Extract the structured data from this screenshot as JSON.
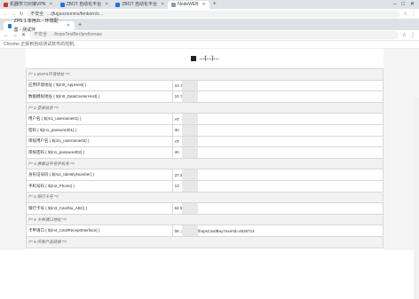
{
  "outer_tabs": [
    {
      "label": "机器学习对接VPN",
      "color": "#d93025",
      "active": false
    },
    {
      "label": "ZBOT 自动化平台",
      "color": "#1a73e8",
      "active": false
    },
    {
      "label": "ZBOT 自动化平台",
      "color": "#1a73e8",
      "active": false
    },
    {
      "label": "NodeWEB",
      "color": "#999999",
      "active": true
    }
  ],
  "outer_toolbar": {
    "security": "不安全",
    "url": "…/jfuguozsonms/fenborn/s…"
  },
  "inner_tab": {
    "label": "ZPS 1.本用JL - 环境配置 - 测试环"
  },
  "inner_toolbar": {
    "security": "不安全",
    "url": "…/bopsTestBer/prefixeraw"
  },
  "notice": "Chrome 正受到自动测试软件的控制。",
  "doc_title": "…(…)…",
  "rows": [
    {
      "type": "section",
      "key": "/**  1.BOPS环境地址 **/"
    },
    {
      "key": "应用环境地址 ( ${m0_AppHost} )",
      "value": "10                  :8080"
    },
    {
      "key": "数据模拟地址 ( ${m0_DataCenterHost} )",
      "value": "10                   :5050"
    },
    {
      "type": "section",
      "key": "/**  2.登录信息 **/"
    },
    {
      "key": "用户名 ( ${m1_username01} )",
      "value": "AT"
    },
    {
      "key": "密码 ( ${m1_password01} )",
      "value": "iKi"
    },
    {
      "key": "审核用户名 ( ${m1_username02} )",
      "value": "AT"
    },
    {
      "key": "审核密码 ( ${m1_password02} )",
      "value": "iKi"
    },
    {
      "type": "section",
      "key": "/**  3.佛像证件号手机号 **/"
    },
    {
      "key": "身份证号码 ( ${m2_IdentityNumber} )",
      "value": "37                  2104972"
    },
    {
      "key": "手机号码 ( ${m2_Phone} )",
      "value": "13"
    },
    {
      "type": "section",
      "key": "/**  4.银行卡号 **/"
    },
    {
      "key": "银行卡号 ( ${m3_CardNo_ABC} )",
      "value": "62                  57074213"
    },
    {
      "type": "section",
      "key": "/**  5.卡申请口地址 **/"
    },
    {
      "key": "卡申请口 ( ${m4_CardReceptInterface} )",
      "value": "htt                  .247:5000/bopsCardBuy?userId=4525714"
    },
    {
      "type": "section",
      "key": "/**  6.所有产品链接 **/"
    }
  ]
}
